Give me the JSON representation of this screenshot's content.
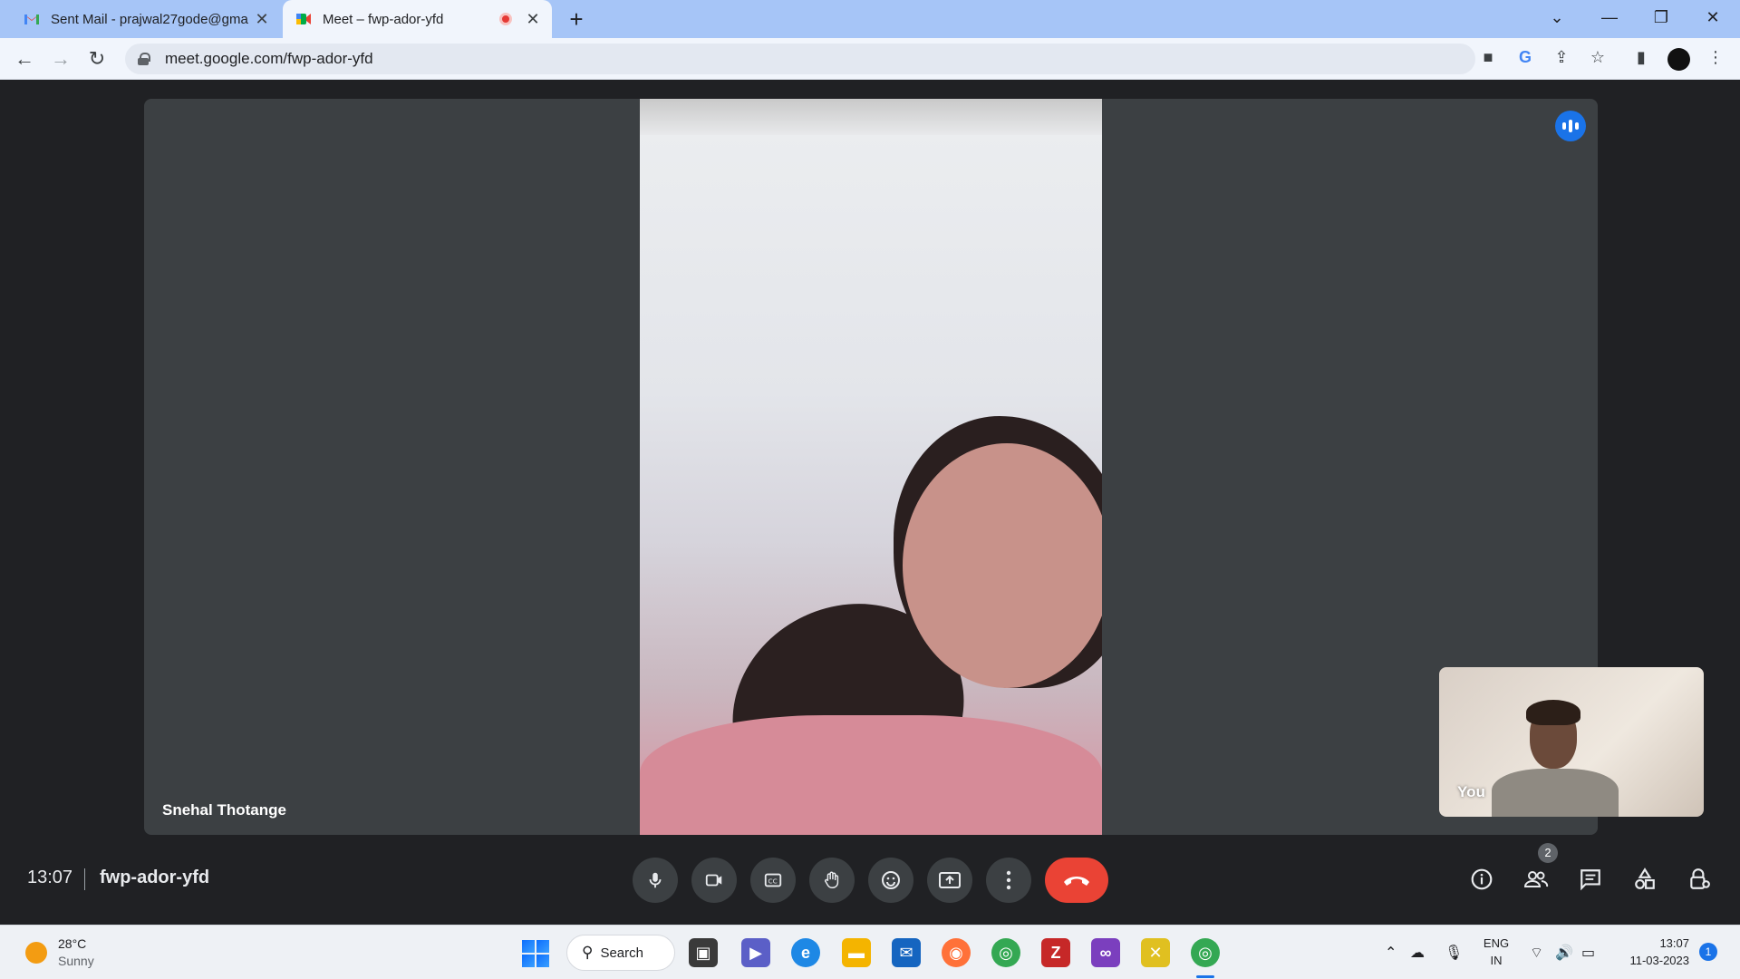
{
  "browser": {
    "tabs": [
      {
        "title": "Sent Mail - prajwal27gode@gma",
        "favicon": "gmail-icon",
        "active": false
      },
      {
        "title": "Meet – fwp-ador-yfd",
        "favicon": "meet-icon",
        "active": true,
        "recording": true
      }
    ],
    "new_tab": "+",
    "address": "meet.google.com/fwp-ador-yfd",
    "window_controls": {
      "dropdown": "⌄",
      "minimize": "—",
      "restore": "❐",
      "close": "✕"
    }
  },
  "meeting": {
    "main_participant": "Snehal Thotange",
    "self_label": "You",
    "time": "13:07",
    "code": "fwp-ador-yfd",
    "participant_count": "2",
    "controls": [
      "microphone-icon",
      "camera-icon",
      "captions-icon",
      "raise-hand-icon",
      "emoji-icon",
      "present-icon",
      "more-options-icon",
      "end-call-icon"
    ],
    "right_controls": [
      "info-icon",
      "people-icon",
      "chat-icon",
      "activities-icon",
      "host-controls-icon"
    ],
    "accent_end": "#ea4335",
    "accent_speaking": "#1a73e8"
  },
  "taskbar": {
    "weather_temp": "28°C",
    "weather_cond": "Sunny",
    "search_label": "Search",
    "lang_top": "ENG",
    "lang_bottom": "IN",
    "clock_time": "13:07",
    "clock_date": "11-03-2023",
    "notifications": "1"
  }
}
